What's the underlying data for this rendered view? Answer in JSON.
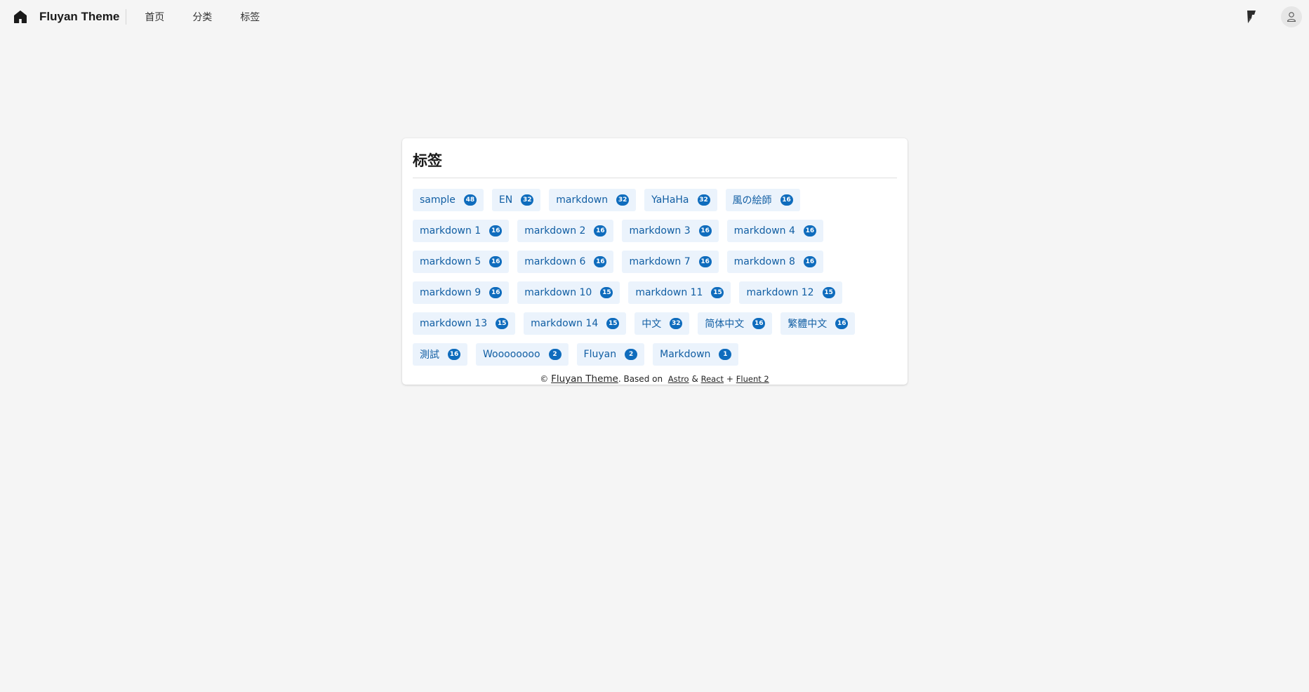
{
  "header": {
    "brand": "Fluyan Theme",
    "nav": [
      {
        "label": "首页"
      },
      {
        "label": "分类"
      },
      {
        "label": "标签"
      }
    ]
  },
  "card": {
    "title": "标签",
    "tags": [
      {
        "label": "sample",
        "count": "48"
      },
      {
        "label": "EN",
        "count": "32"
      },
      {
        "label": "markdown",
        "count": "32"
      },
      {
        "label": "YaHaHa",
        "count": "32"
      },
      {
        "label": "風の絵師",
        "count": "16"
      },
      {
        "label": "markdown 1",
        "count": "16"
      },
      {
        "label": "markdown 2",
        "count": "16"
      },
      {
        "label": "markdown 3",
        "count": "16"
      },
      {
        "label": "markdown 4",
        "count": "16"
      },
      {
        "label": "markdown 5",
        "count": "16"
      },
      {
        "label": "markdown 6",
        "count": "16"
      },
      {
        "label": "markdown 7",
        "count": "16"
      },
      {
        "label": "markdown 8",
        "count": "16"
      },
      {
        "label": "markdown 9",
        "count": "16"
      },
      {
        "label": "markdown 10",
        "count": "15"
      },
      {
        "label": "markdown 11",
        "count": "15"
      },
      {
        "label": "markdown 12",
        "count": "15"
      },
      {
        "label": "markdown 13",
        "count": "15"
      },
      {
        "label": "markdown 14",
        "count": "15"
      },
      {
        "label": "中文",
        "count": "32"
      },
      {
        "label": "简体中文",
        "count": "16"
      },
      {
        "label": "繁體中文",
        "count": "16"
      },
      {
        "label": "測試",
        "count": "16"
      },
      {
        "label": "Woooooooo",
        "count": "2"
      },
      {
        "label": "Fluyan",
        "count": "2"
      },
      {
        "label": "Markdown",
        "count": "1"
      }
    ]
  },
  "footer": {
    "copyright": "©",
    "brand_link": "Fluyan Theme",
    "based_on": ".  Based on",
    "astro": "Astro",
    "amp": "&",
    "react": "React",
    "plus": "+",
    "fluent": "Fluent 2"
  },
  "colors": {
    "accent": "#0f6cbd",
    "tag_bg": "#ebf3fc",
    "tag_text": "#115ea3",
    "page_bg": "#f5f5f5"
  },
  "icons": {
    "home": "home-icon",
    "fluent": "fluent-logo-icon",
    "user": "person-icon"
  }
}
